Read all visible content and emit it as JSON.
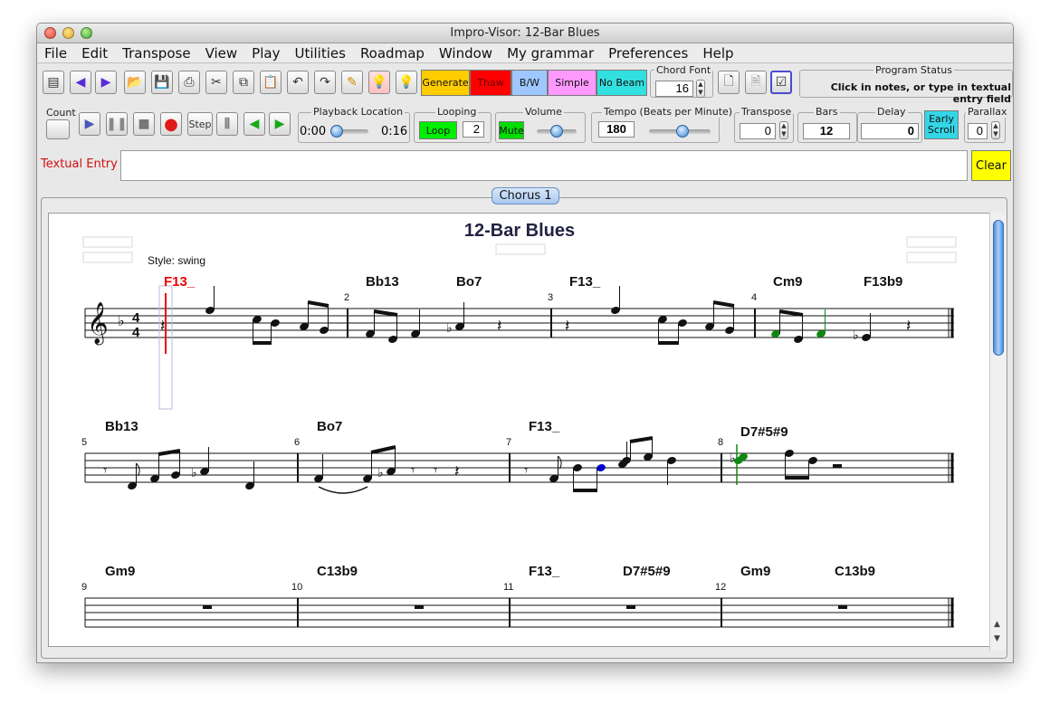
{
  "window": {
    "title": "Impro-Visor: 12-Bar Blues"
  },
  "menus": [
    "File",
    "Edit",
    "Transpose",
    "View",
    "Play",
    "Utilities",
    "Roadmap",
    "Window",
    "My grammar",
    "Preferences",
    "Help"
  ],
  "toolbar": {
    "generate_label": "Generate",
    "thaw_label": "Thaw",
    "bw_label": "B/W",
    "simple_label": "Simple",
    "no_beam_label": "No Beam",
    "chord_font_label": "Chord Font",
    "chord_font_value": "16",
    "program_status_label": "Program Status",
    "program_status_text": "Click in notes, or type in textual entry field"
  },
  "playback": {
    "count_label": "Count",
    "step_label": "Step",
    "location_label": "Playback Location",
    "time_start": "0:00",
    "time_end": "0:16",
    "position_fraction": 0.0,
    "looping_label": "Looping",
    "loop_button": "Loop",
    "loop_count": "2",
    "volume_label": "Volume",
    "mute_button": "Mute",
    "volume_fraction": 0.5,
    "tempo_label": "Tempo (Beats per Minute)",
    "tempo_value": "180",
    "tempo_fraction": 0.55,
    "transpose_label": "Transpose",
    "transpose_value": "0",
    "bars_label": "Bars",
    "bars_value": "12",
    "delay_label": "Delay",
    "delay_value": "0",
    "early_scroll_label": "Early Scroll",
    "parallax_label": "Parallax",
    "parallax_value": "0"
  },
  "textual_entry": {
    "label": "Textual Entry",
    "value": "",
    "clear_button": "Clear"
  },
  "chorus_tab": "Chorus 1",
  "score": {
    "title": "12-Bar Blues",
    "style_label": "Style: swing",
    "systems": [
      {
        "measures": [
          {
            "number": "",
            "chords": [
              "F13_"
            ]
          },
          {
            "number": "2",
            "chords": [
              "Bb13",
              "Bo7"
            ]
          },
          {
            "number": "3",
            "chords": [
              "F13_"
            ]
          },
          {
            "number": "4",
            "chords": [
              "Cm9",
              "F13b9"
            ]
          }
        ]
      },
      {
        "measures": [
          {
            "number": "5",
            "chords": [
              "Bb13"
            ]
          },
          {
            "number": "6",
            "chords": [
              "Bo7"
            ]
          },
          {
            "number": "7",
            "chords": [
              "F13_"
            ]
          },
          {
            "number": "8",
            "chords": [
              "D7#5#9"
            ]
          }
        ]
      },
      {
        "measures": [
          {
            "number": "9",
            "chords": [
              "Gm9"
            ]
          },
          {
            "number": "10",
            "chords": [
              "C13b9"
            ]
          },
          {
            "number": "11",
            "chords": [
              "F13_",
              "D7#5#9"
            ]
          },
          {
            "number": "12",
            "chords": [
              "Gm9",
              "C13b9"
            ]
          }
        ]
      }
    ]
  },
  "colors": {
    "generate": "#ffcc00",
    "thaw": "#ff0000",
    "bw": "#9fc7ff",
    "simple": "#ff99ff",
    "no_beam": "#33e0e0",
    "loop": "#00ee00",
    "mute": "#00dd00",
    "early_scroll": "#33d6e6",
    "clear": "#ffff00",
    "current_chord": "#ee0000",
    "chord_tone": "#118811",
    "color_tone": "#0000cc"
  }
}
